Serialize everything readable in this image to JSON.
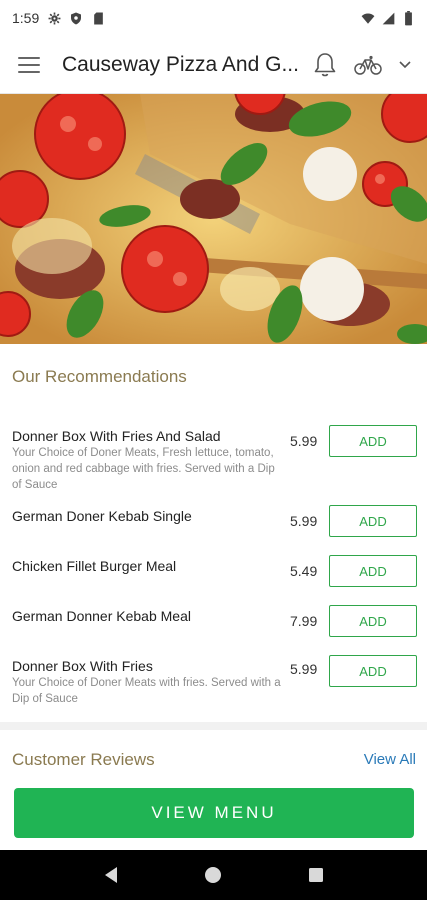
{
  "status_bar": {
    "time": "1:59",
    "icons": [
      "settings-icon",
      "shield-icon",
      "sd-card-icon",
      "wifi-icon",
      "signal-icon",
      "battery-icon"
    ]
  },
  "app_bar": {
    "title": "Causeway Pizza And G...",
    "icons": [
      "menu-icon",
      "bell-icon",
      "bicycle-icon",
      "chevron-down-icon"
    ]
  },
  "recommendations": {
    "title": "Our Recommendations",
    "items": [
      {
        "name": "Donner Box With Fries And Salad",
        "description": "Your Choice of Doner Meats, Fresh lettuce, tomato, onion and red cabbage with fries. Served with a Dip of Sauce",
        "price": "5.99",
        "button": "ADD"
      },
      {
        "name": "German Doner Kebab Single",
        "description": "",
        "price": "5.99",
        "button": "ADD"
      },
      {
        "name": "Chicken Fillet Burger Meal",
        "description": "",
        "price": "5.49",
        "button": "ADD"
      },
      {
        "name": "German Donner Kebab Meal",
        "description": "",
        "price": "7.99",
        "button": "ADD"
      },
      {
        "name": "Donner Box With Fries",
        "description": "Your Choice of Doner Meats with fries. Served with a Dip of Sauce",
        "price": "5.99",
        "button": "ADD"
      }
    ]
  },
  "reviews": {
    "title": "Customer Reviews",
    "view_all": "View All"
  },
  "cta": {
    "label": "VIEW MENU"
  },
  "nav": {
    "icons": [
      "back-icon",
      "home-icon",
      "recents-icon"
    ]
  },
  "colors": {
    "accent_green": "#20b454",
    "add_green": "#2fa64a",
    "section_title": "#8a7a50",
    "link_blue": "#2a7ab8"
  }
}
